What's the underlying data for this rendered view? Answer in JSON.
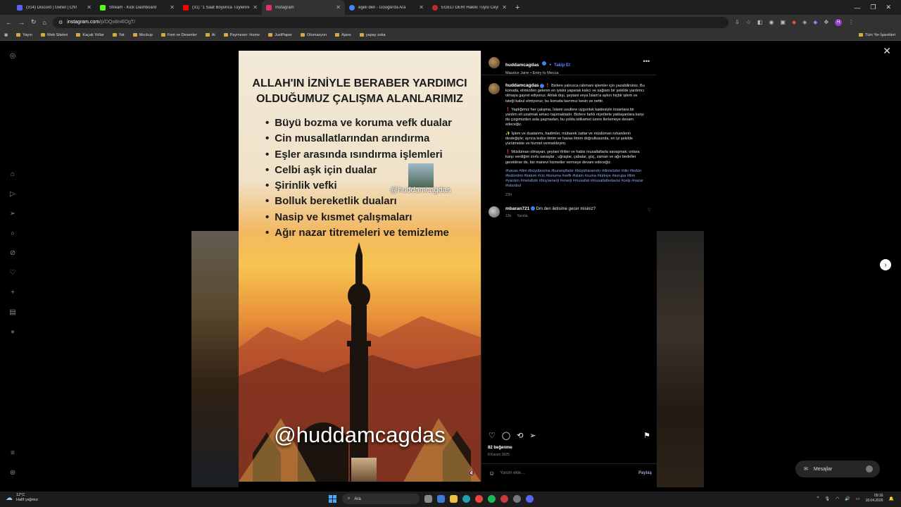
{
  "browser": {
    "tabs": [
      {
        "title": "(314) Discord | Genel | CN!",
        "color": "#5865f2",
        "active": false
      },
      {
        "title": "Stream - Kick Dashboard",
        "color": "#53fc18",
        "active": false
      },
      {
        "title": "(31) \"1 Saat Boyunca Tüylerini",
        "color": "#ff0000",
        "active": false
      },
      {
        "title": "Instagram",
        "color": "#e1306c",
        "active": true
      },
      {
        "title": "egeli deri - Google'da Ara",
        "color": "#4285f4",
        "active": false
      },
      {
        "title": "EGELİ DERİ Hakiki Tüylü Ceyteri",
        "color": "#c62828",
        "active": false
      }
    ],
    "url_host": "instagram.com",
    "url_path": "/p/DQo8n4lOgT/",
    "bookmarks": [
      "Yayın",
      "Web Siteleri",
      "Kaçak Yollar",
      "Yat",
      "Mockup",
      "Font ve Desenler",
      "Ai",
      "Paymeser: Home",
      "JustPaper",
      "Otomasyon",
      "Ajans",
      "yapay zeka"
    ],
    "all_bookmarks": "Tüm Yer İşaretleri"
  },
  "poster": {
    "title_line1": "ALLAH'IN İZNİYLE BERABER YARDIMCI",
    "title_line2": "OLDUĞUMUZ ÇALIŞMA ALANLARIMIZ",
    "items": [
      "Büyü bozma ve koruma vefk dualar",
      "Cin musallatlarından arındırma",
      "Eşler arasında ısındırma işlemleri",
      "Celbi aşk için dualar",
      "Şirinlik vefki",
      "Bolluk bereketlik duaları",
      "Nasip ve kısmet çalışmaları",
      "Ağır nazar titremeleri ve temizleme"
    ],
    "watermark": "@huddamcagdas",
    "handle": "@huddamcagdas"
  },
  "post": {
    "username": "huddamcagdas",
    "follow_label": "Takip Et",
    "audio": "Maurice Jarre • Entry to Mecca",
    "caption_para1": "❗ Bizlere yalnızca rahmani işlemler için yazabilirsiniz. Bu konuda, elimizden gelenin en iyisini yaparak kalıcı ve sağlam bir şekilde yardımcı olmaya gayret ediyoruz. Ahlak dışı, şeytani veya İslam'a aykırı hiçbir işlem ve isteği kabul etmiyoruz; bu konuda tavrımız kesin ve nettir.",
    "caption_para2": "❗ Yaptığımız her çalışma, İslami usullere uygunluk kaidesiyle insanlara bir yardım eli uzatmak amacı taşımaktadır. Bizlere farklı niyetlerle yaklaşanlara karşı da çizgimizden asla şaşmadan, bu yolda istikamet üzere ilerlemeye devam edeceğiz.",
    "caption_para3": "✨ İşlem ve dualarımı, hadimler, mübarek zatlar ve müslüman ruhanilerin desteğiyle; ayrıca ledün ilmim ve havas ilmim doğrultusunda, en iyi şekilde yürütmekte ve hizmet vermekteyim.",
    "caption_para4": "❗ Müslüman olmayan, şeytani ifritler ve habis musallatlarla savaşmak; onlara karşı verdiğim zorlu savaşlar , uğraşlar, çabalar, güç, zaman ve ağır bedeller gerektirse de, biz manevi hizmetler vermeye devam edeceğiz.",
    "hashtags": "#havas #ilim #büyübozma #kuranşifadır #büyüharamdır #dinisözler #din #ledün #ledünilmi #bakım #cin #koruma #vefk #islam #cuma #türkiye #avrupa #ilim #yardım #metafizik #büyüenerji #enerji #musallat #musallattedavisi #celp #nazar #istanbul",
    "caption_time": "23h",
    "comment_user": "mbaran721",
    "comment_text": "Dm den iletisime gecer misiniz?",
    "comment_time": "13h",
    "reply_label": "Yanıtla",
    "likes": "82 beğenme",
    "date": "8 Kasım 2025",
    "comment_placeholder": "Yorum ekle...",
    "share_label": "Paylaş"
  },
  "messages_label": "Mesajlar",
  "taskbar": {
    "temp": "12°C",
    "weather": "Hafif yağmur",
    "search": "Ara",
    "time": "09:16",
    "date": "18.04.2026"
  },
  "icons": {
    "close": "close-icon",
    "next": "chevron-right-icon",
    "like": "heart-icon",
    "comment": "comment-icon",
    "repost": "repost-icon",
    "share": "send-icon",
    "save": "bookmark-icon"
  }
}
